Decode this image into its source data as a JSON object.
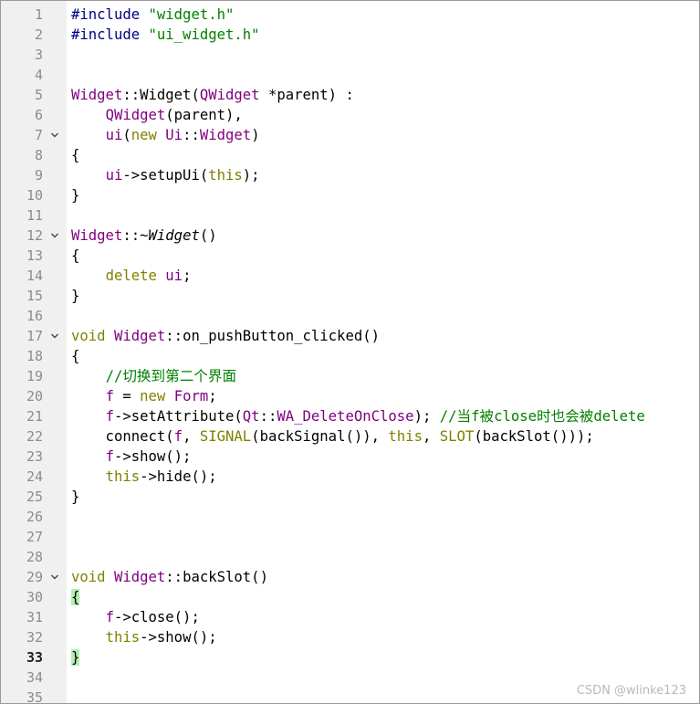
{
  "colors": {
    "keyword": "#808000",
    "type": "#800080",
    "comment": "#008000",
    "string": "#008000",
    "preprocessor": "#000080",
    "gutter_bg": "#f0f0f0",
    "brace_highlight": "#b4eeb4"
  },
  "editor": {
    "current_line": 33,
    "lines": [
      {
        "n": "1",
        "fold": false,
        "tokens": [
          {
            "t": "#include ",
            "c": "pp"
          },
          {
            "t": "\"widget.h\"",
            "c": "st"
          }
        ]
      },
      {
        "n": "2",
        "fold": false,
        "tokens": [
          {
            "t": "#include ",
            "c": "pp"
          },
          {
            "t": "\"ui_widget.h\"",
            "c": "st"
          }
        ]
      },
      {
        "n": "3",
        "fold": false,
        "tokens": []
      },
      {
        "n": "4",
        "fold": false,
        "tokens": []
      },
      {
        "n": "5",
        "fold": false,
        "tokens": [
          {
            "t": "Widget",
            "c": "ty"
          },
          {
            "t": "::Widget(",
            "c": ""
          },
          {
            "t": "QWidget",
            "c": "ty"
          },
          {
            "t": " *parent) :",
            "c": ""
          }
        ]
      },
      {
        "n": "6",
        "fold": false,
        "tokens": [
          {
            "t": "    ",
            "c": ""
          },
          {
            "t": "QWidget",
            "c": "ty"
          },
          {
            "t": "(parent),",
            "c": ""
          }
        ]
      },
      {
        "n": "7",
        "fold": true,
        "tokens": [
          {
            "t": "    ",
            "c": ""
          },
          {
            "t": "ui",
            "c": "ty"
          },
          {
            "t": "(",
            "c": ""
          },
          {
            "t": "new",
            "c": "kw"
          },
          {
            "t": " ",
            "c": ""
          },
          {
            "t": "Ui",
            "c": "ty"
          },
          {
            "t": "::",
            "c": ""
          },
          {
            "t": "Widget",
            "c": "ty"
          },
          {
            "t": ")",
            "c": ""
          }
        ]
      },
      {
        "n": "8",
        "fold": false,
        "tokens": [
          {
            "t": "{",
            "c": ""
          }
        ]
      },
      {
        "n": "9",
        "fold": false,
        "tokens": [
          {
            "t": "    ",
            "c": ""
          },
          {
            "t": "ui",
            "c": "ty"
          },
          {
            "t": "->setupUi(",
            "c": ""
          },
          {
            "t": "this",
            "c": "kw"
          },
          {
            "t": ");",
            "c": ""
          }
        ]
      },
      {
        "n": "10",
        "fold": false,
        "tokens": [
          {
            "t": "}",
            "c": ""
          }
        ]
      },
      {
        "n": "11",
        "fold": false,
        "tokens": []
      },
      {
        "n": "12",
        "fold": true,
        "tokens": [
          {
            "t": "Widget",
            "c": "ty"
          },
          {
            "t": "::~",
            "c": ""
          },
          {
            "t": "Widget",
            "c": "it"
          },
          {
            "t": "()",
            "c": ""
          }
        ]
      },
      {
        "n": "13",
        "fold": false,
        "tokens": [
          {
            "t": "{",
            "c": ""
          }
        ]
      },
      {
        "n": "14",
        "fold": false,
        "tokens": [
          {
            "t": "    ",
            "c": ""
          },
          {
            "t": "delete",
            "c": "kw"
          },
          {
            "t": " ",
            "c": ""
          },
          {
            "t": "ui",
            "c": "ty"
          },
          {
            "t": ";",
            "c": ""
          }
        ]
      },
      {
        "n": "15",
        "fold": false,
        "tokens": [
          {
            "t": "}",
            "c": ""
          }
        ]
      },
      {
        "n": "16",
        "fold": false,
        "tokens": []
      },
      {
        "n": "17",
        "fold": true,
        "tokens": [
          {
            "t": "void",
            "c": "kw"
          },
          {
            "t": " ",
            "c": ""
          },
          {
            "t": "Widget",
            "c": "ty"
          },
          {
            "t": "::on_pushButton_clicked()",
            "c": ""
          }
        ]
      },
      {
        "n": "18",
        "fold": false,
        "tokens": [
          {
            "t": "{",
            "c": ""
          }
        ]
      },
      {
        "n": "19",
        "fold": false,
        "tokens": [
          {
            "t": "    ",
            "c": ""
          },
          {
            "t": "//切换到第二个界面",
            "c": "cm"
          }
        ]
      },
      {
        "n": "20",
        "fold": false,
        "tokens": [
          {
            "t": "    ",
            "c": ""
          },
          {
            "t": "f",
            "c": "ty"
          },
          {
            "t": " = ",
            "c": ""
          },
          {
            "t": "new",
            "c": "kw"
          },
          {
            "t": " ",
            "c": ""
          },
          {
            "t": "Form",
            "c": "ty"
          },
          {
            "t": ";",
            "c": ""
          }
        ]
      },
      {
        "n": "21",
        "fold": false,
        "tokens": [
          {
            "t": "    ",
            "c": ""
          },
          {
            "t": "f",
            "c": "ty"
          },
          {
            "t": "->setAttribute(",
            "c": ""
          },
          {
            "t": "Qt",
            "c": "ty"
          },
          {
            "t": "::",
            "c": ""
          },
          {
            "t": "WA_DeleteOnClose",
            "c": "ty"
          },
          {
            "t": "); ",
            "c": ""
          },
          {
            "t": "//当f被close时也会被delete",
            "c": "cm"
          }
        ]
      },
      {
        "n": "22",
        "fold": false,
        "tokens": [
          {
            "t": "    connect(",
            "c": ""
          },
          {
            "t": "f",
            "c": "ty"
          },
          {
            "t": ", ",
            "c": ""
          },
          {
            "t": "SIGNAL",
            "c": "kw"
          },
          {
            "t": "(backSignal()), ",
            "c": ""
          },
          {
            "t": "this",
            "c": "kw"
          },
          {
            "t": ", ",
            "c": ""
          },
          {
            "t": "SLOT",
            "c": "kw"
          },
          {
            "t": "(backSlot()));",
            "c": ""
          }
        ]
      },
      {
        "n": "23",
        "fold": false,
        "tokens": [
          {
            "t": "    ",
            "c": ""
          },
          {
            "t": "f",
            "c": "ty"
          },
          {
            "t": "->show();",
            "c": ""
          }
        ]
      },
      {
        "n": "24",
        "fold": false,
        "tokens": [
          {
            "t": "    ",
            "c": ""
          },
          {
            "t": "this",
            "c": "kw"
          },
          {
            "t": "->hide();",
            "c": ""
          }
        ]
      },
      {
        "n": "25",
        "fold": false,
        "tokens": [
          {
            "t": "}",
            "c": ""
          }
        ]
      },
      {
        "n": "26",
        "fold": false,
        "tokens": []
      },
      {
        "n": "27",
        "fold": false,
        "tokens": []
      },
      {
        "n": "28",
        "fold": false,
        "tokens": []
      },
      {
        "n": "29",
        "fold": true,
        "tokens": [
          {
            "t": "void",
            "c": "kw"
          },
          {
            "t": " ",
            "c": ""
          },
          {
            "t": "Widget",
            "c": "ty"
          },
          {
            "t": "::backSlot()",
            "c": ""
          }
        ]
      },
      {
        "n": "30",
        "fold": false,
        "tokens": [
          {
            "t": "{",
            "c": "brace-hl"
          }
        ]
      },
      {
        "n": "31",
        "fold": false,
        "tokens": [
          {
            "t": "    ",
            "c": ""
          },
          {
            "t": "f",
            "c": "ty"
          },
          {
            "t": "->close();",
            "c": ""
          }
        ]
      },
      {
        "n": "32",
        "fold": false,
        "tokens": [
          {
            "t": "    ",
            "c": ""
          },
          {
            "t": "this",
            "c": "kw"
          },
          {
            "t": "->show();",
            "c": ""
          }
        ]
      },
      {
        "n": "33",
        "fold": false,
        "tokens": [
          {
            "t": "}",
            "c": "brace-hl"
          }
        ]
      },
      {
        "n": "34",
        "fold": false,
        "tokens": []
      },
      {
        "n": "35",
        "fold": false,
        "tokens": []
      }
    ]
  },
  "watermark": "CSDN @wlinke123"
}
